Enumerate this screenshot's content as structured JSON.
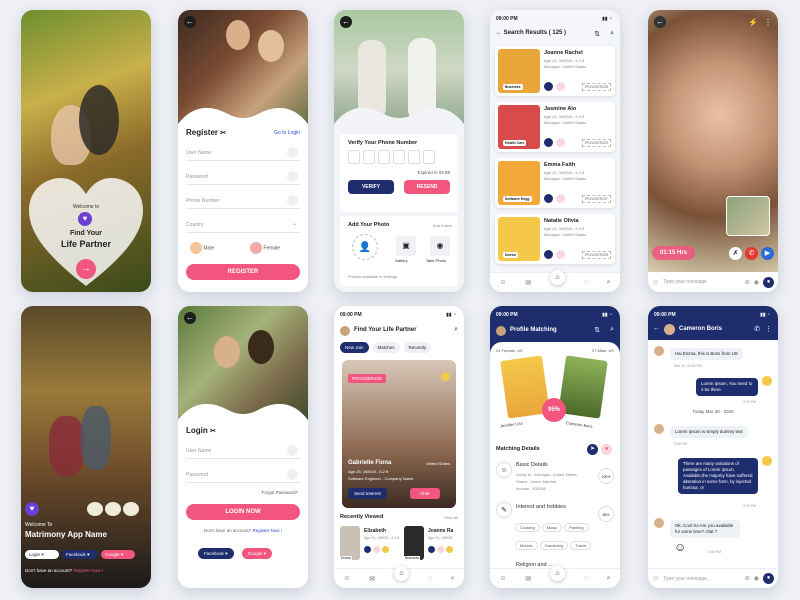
{
  "colors": {
    "pink": "#f2557e",
    "navy": "#1d2d6e",
    "light": "#eef0f4"
  },
  "splash1": {
    "welcome": "Welcome to",
    "title_line1": "Find Your",
    "title_line2": "Life Partner"
  },
  "register": {
    "title": "Register",
    "goto_login": "Go to Login",
    "user_name": "User Name",
    "password": "Password",
    "phone": "Phone Number",
    "country": "Country",
    "male": "Male",
    "female": "Female",
    "button": "REGISTER"
  },
  "verify": {
    "title": "Verify Your Phone Number",
    "expired": "Expired in 04:59",
    "verify_btn": "VERIFY",
    "resend_btn": "RESEND",
    "add_photo": "Add Your Photo",
    "add_later": "Add it later",
    "gallery": "Gallery",
    "take_photo": "Take Photo",
    "privacy": "Privacy available in settings"
  },
  "search": {
    "time": "09:00 PM",
    "title": "Search Results ( 125 )",
    "results": [
      {
        "name": "Joanne Rachel",
        "meta1": "Age 24, 165CM - 5.2 ft",
        "meta2": "Michigan, United States",
        "tag": "Business",
        "id": "PROUSER245"
      },
      {
        "name": "Jasmine Alo",
        "meta1": "Age 24, 165CM - 5.4 ft",
        "meta2": "Michigan, United States",
        "tag": "Health Care",
        "id": "PROUSER223"
      },
      {
        "name": "Emma Faith",
        "meta1": "Age 22, 165CM - 5.2 ft",
        "meta2": "Michigan, United States",
        "tag": "Software Engg",
        "id": "PROUSER237"
      },
      {
        "name": "Natalie Olivia",
        "meta1": "Age 24, 165CM - 5.4 ft",
        "meta2": "Michigan, United States",
        "tag": "Doctor",
        "id": "PROUSER259"
      }
    ]
  },
  "video": {
    "duration": "01:15 Hrs",
    "placeholder": "Type your message"
  },
  "welcome": {
    "welcome": "Welcome To",
    "app_name": "Matrimony App Name",
    "login": "Login",
    "facebook": "Facebook",
    "google": "Google",
    "no_account": "Don't have an account?",
    "register": "Register Now !"
  },
  "login": {
    "title": "Login",
    "user_name": "User Name",
    "password": "Password",
    "forgot": "Forgot Password?",
    "button": "LOGIN NOW",
    "no_account": "Don't have an account?",
    "register": "Register Now !",
    "facebook": "Facebook",
    "google": "Google"
  },
  "find": {
    "time": "09:00 PM",
    "title": "Find Your Life Partner",
    "tabs": [
      "New Join",
      "Matches",
      "Recently"
    ],
    "id": "PROUSER245",
    "name": "Gabrielle Fiona",
    "location": "United States",
    "meta1": "Age 25, 165CM - 5.2 ft",
    "meta2": "Software Engineer - Company Name",
    "send": "Send Interest",
    "chat": "Chat",
    "recent_title": "Recently Viewed",
    "view_all": "View All",
    "recent": [
      {
        "name": "Elizabeth",
        "meta": "Age 24, 165CM - 5.2 ft",
        "tag": "Doctor"
      },
      {
        "name": "Joanne Ra",
        "meta": "Age 24, 165CM",
        "tag": "Business"
      }
    ]
  },
  "matching": {
    "time": "09:00 PM",
    "title": "Profile Matching",
    "left_info": "24 Female, US",
    "right_info": "27 Male, US",
    "left_name": "Jennifer Lisa",
    "right_name": "Cameron Boris",
    "percent": "95%",
    "details_title": "Matching Details",
    "sections": [
      {
        "title": "Basic Details",
        "pct": "100%",
        "lines": [
          "Living In - Michigan, United States",
          "Status - Never Married",
          "Income - $32000"
        ]
      },
      {
        "title": "Interest and hobbies",
        "pct": "95%",
        "lines": []
      },
      {
        "title": "Religion and ...",
        "pct": "",
        "lines": []
      }
    ],
    "hobbies": [
      "Cooking",
      "Music",
      "Painting",
      "Movies",
      "Gardening",
      "Travel"
    ]
  },
  "chat": {
    "time": "09:00 PM",
    "name": "Cameron Boris",
    "today": "Today  Mar 30 - 2025",
    "placeholder": "Type your message...",
    "messages": [
      {
        "side": "left",
        "text": "Hai Emma, this is Boris from US",
        "time": "Mar 29, 05:00 PM"
      },
      {
        "side": "right",
        "text": "Lorem Ipsum, You need to 4 be there",
        "time": "2:00 PM"
      },
      {
        "side": "left",
        "text": "Lorem Ipsum is simply dummy text",
        "time": "2:00 PM"
      },
      {
        "side": "right",
        "text": "There are many variations of passages of Lorem Ipsum. Available,the majority have suffered alteration in some form, by injected humour, or",
        "time": "2:00 PM"
      },
      {
        "side": "left",
        "text": "Ok, Cool So Are you available for some time? chat ?",
        "time": "2:00 PM"
      }
    ]
  }
}
